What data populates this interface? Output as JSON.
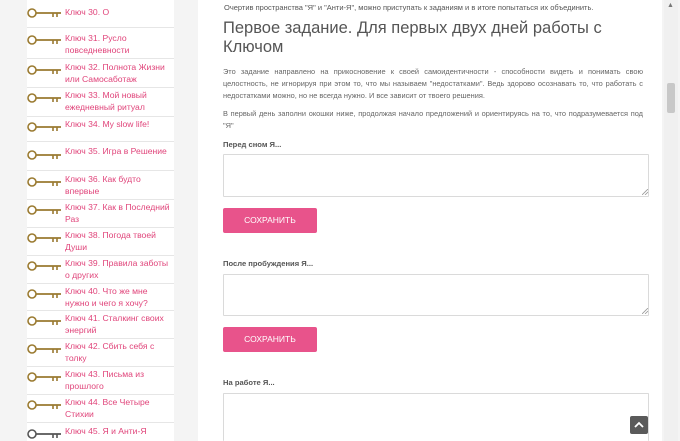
{
  "sidebar": {
    "items": [
      {
        "label": "Ключ 30. О"
      },
      {
        "label": "Ключ 31. Русло повседневности"
      },
      {
        "label": "Ключ 32. Полнота Жизни или Самосаботаж"
      },
      {
        "label": "Ключ 33. Мой новый ежедневный ритуал"
      },
      {
        "label": "Ключ 34. My slow life!"
      },
      {
        "label": "Ключ 35. Игра в Решение"
      },
      {
        "label": "Ключ 36. Как будто впервые"
      },
      {
        "label": "Ключ 37. Как в Последний Раз"
      },
      {
        "label": "Ключ 38. Погода твоей Души"
      },
      {
        "label": "Ключ 39. Правила заботы о других"
      },
      {
        "label": "Ключ 40. Что же мне нужно и чего я хочу?"
      },
      {
        "label": "Ключ 41. Сталкинг своих энергий"
      },
      {
        "label": "Ключ 42. Сбить себя с толку"
      },
      {
        "label": "Ключ 43. Письма из прошлого"
      },
      {
        "label": "Ключ 44. Все Четыре Стихии"
      },
      {
        "label": "Ключ 45. Я и Анти-Я"
      }
    ]
  },
  "main": {
    "intro": "Очертив пространства \"Я\" и \"Анти-Я\", можно приступать к заданиям и в итоге попытаться их объединить.",
    "heading": "Первое задание. Для первых двух дней работы с Ключом",
    "para1": "Это задание направлено на прикосновение к своей самоидентичности - способности видеть и понимать свою целостность, не игнорируя при этом то, что мы называем \"недостатками\". Ведь здорово осознавать то, что работать с недостатками можно, но не всегда нужно. И все зависит от твоего решения.",
    "para2": "В первый день заполни окошки ниже, продолжая начало предложений и ориентируясь на то, что подразумевается под \"Я\"",
    "fields": [
      {
        "label": "Перед сном Я...",
        "value": ""
      },
      {
        "label": "После пробуждения Я...",
        "value": ""
      },
      {
        "label": "На работе Я...",
        "value": ""
      }
    ],
    "save_label": "СОХРАНИТЬ"
  },
  "colors": {
    "accent": "#e8538b",
    "link": "#e0447a"
  },
  "icons": {
    "key": "key-icon",
    "scroll_top": "chevron-up-icon"
  }
}
